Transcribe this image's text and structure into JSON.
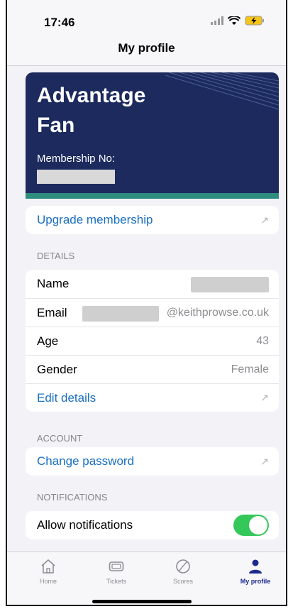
{
  "status": {
    "time": "17:46"
  },
  "nav": {
    "title": "My profile"
  },
  "card": {
    "tier": "Advantage Fan",
    "membership_label": "Membership No:"
  },
  "upgrade": {
    "label": "Upgrade membership"
  },
  "details": {
    "header": "DETAILS",
    "name_label": "Name",
    "email_label": "Email",
    "email_suffix": "@keithprowse.co.uk",
    "age_label": "Age",
    "age_value": "43",
    "gender_label": "Gender",
    "gender_value": "Female",
    "edit_label": "Edit details"
  },
  "account": {
    "header": "ACCOUNT",
    "change_password": "Change password"
  },
  "notifications": {
    "header": "NOTIFICATIONS",
    "allow_label": "Allow notifications",
    "enabled": true
  },
  "tabs": [
    {
      "label": "Home",
      "icon": "home-icon"
    },
    {
      "label": "Tickets",
      "icon": "ticket-icon"
    },
    {
      "label": "Scores",
      "icon": "ball-icon"
    },
    {
      "label": "My profile",
      "icon": "person-icon"
    }
  ],
  "colors": {
    "accent": "#1a6fc0",
    "card": "#1c2a5e",
    "card_stripe": "#2f8d7f",
    "toggle_on": "#34c759",
    "active_tab": "#1c2a8e"
  }
}
